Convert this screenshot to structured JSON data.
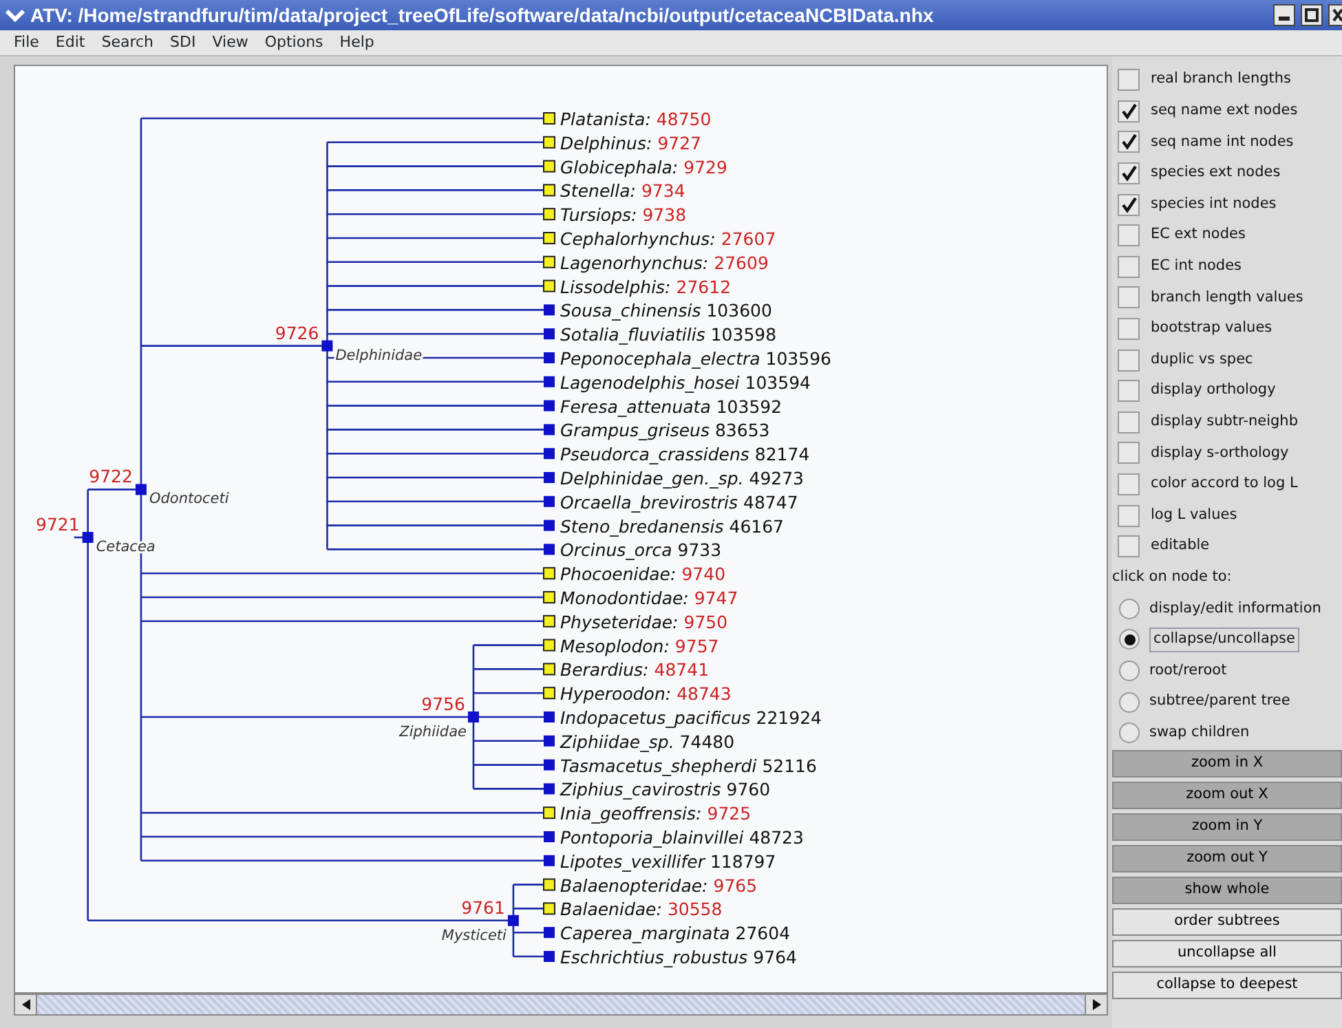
{
  "window": {
    "title": "ATV: /Home/strandfuru/tim/data/project_treeOfLife/software/data/ncbi/output/cetaceaNCBIData.nhx"
  },
  "menu": [
    "File",
    "Edit",
    "Search",
    "SDI",
    "View",
    "Options",
    "Help"
  ],
  "tree": {
    "kind": "internal",
    "label": "Cetacea",
    "id": "9721",
    "children": [
      {
        "kind": "internal",
        "label": "Odontoceti",
        "id": "9722",
        "children": [
          {
            "kind": "collapsed",
            "name": "Platanista:",
            "id": "48750"
          },
          {
            "kind": "internal",
            "label": "Delphinidae",
            "id": "9726",
            "children": [
              {
                "kind": "collapsed",
                "name": "Delphinus:",
                "id": "9727"
              },
              {
                "kind": "collapsed",
                "name": "Globicephala:",
                "id": "9729"
              },
              {
                "kind": "collapsed",
                "name": "Stenella:",
                "id": "9734"
              },
              {
                "kind": "collapsed",
                "name": "Tursiops:",
                "id": "9738"
              },
              {
                "kind": "collapsed",
                "name": "Cephalorhynchus:",
                "id": "27607"
              },
              {
                "kind": "collapsed",
                "name": "Lagenorhynchus:",
                "id": "27609"
              },
              {
                "kind": "collapsed",
                "name": "Lissodelphis:",
                "id": "27612"
              },
              {
                "kind": "leaf",
                "name": "Sousa_chinensis",
                "id": "103600"
              },
              {
                "kind": "leaf",
                "name": "Sotalia_fluviatilis",
                "id": "103598"
              },
              {
                "kind": "leaf",
                "name": "Peponocephala_electra",
                "id": "103596"
              },
              {
                "kind": "leaf",
                "name": "Lagenodelphis_hosei",
                "id": "103594"
              },
              {
                "kind": "leaf",
                "name": "Feresa_attenuata",
                "id": "103592"
              },
              {
                "kind": "leaf",
                "name": "Grampus_griseus",
                "id": "83653"
              },
              {
                "kind": "leaf",
                "name": "Pseudorca_crassidens",
                "id": "82174"
              },
              {
                "kind": "leaf",
                "name": "Delphinidae_gen._sp.",
                "id": "49273"
              },
              {
                "kind": "leaf",
                "name": "Orcaella_brevirostris",
                "id": "48747"
              },
              {
                "kind": "leaf",
                "name": "Steno_bredanensis",
                "id": "46167"
              },
              {
                "kind": "leaf",
                "name": "Orcinus_orca",
                "id": "9733"
              }
            ]
          },
          {
            "kind": "collapsed",
            "name": "Phocoenidae:",
            "id": "9740"
          },
          {
            "kind": "collapsed",
            "name": "Monodontidae:",
            "id": "9747"
          },
          {
            "kind": "collapsed",
            "name": "Physeteridae:",
            "id": "9750"
          },
          {
            "kind": "internal",
            "label": "Ziphiidae",
            "id": "9756",
            "children": [
              {
                "kind": "collapsed",
                "name": "Mesoplodon:",
                "id": "9757"
              },
              {
                "kind": "collapsed",
                "name": "Berardius:",
                "id": "48741"
              },
              {
                "kind": "collapsed",
                "name": "Hyperoodon:",
                "id": "48743"
              },
              {
                "kind": "leaf",
                "name": "Indopacetus_pacificus",
                "id": "221924"
              },
              {
                "kind": "leaf",
                "name": "Ziphiidae_sp.",
                "id": "74480"
              },
              {
                "kind": "leaf",
                "name": "Tasmacetus_shepherdi",
                "id": "52116"
              },
              {
                "kind": "leaf",
                "name": "Ziphius_cavirostris",
                "id": "9760"
              }
            ]
          },
          {
            "kind": "collapsed",
            "name": "Inia_geoffrensis:",
            "id": "9725"
          },
          {
            "kind": "leaf",
            "name": "Pontoporia_blainvillei",
            "id": "48723"
          },
          {
            "kind": "leaf",
            "name": "Lipotes_vexillifer",
            "id": "118797"
          }
        ]
      },
      {
        "kind": "internal",
        "label": "Mysticeti",
        "id": "9761",
        "children": [
          {
            "kind": "collapsed",
            "name": "Balaenopteridae:",
            "id": "9765"
          },
          {
            "kind": "collapsed",
            "name": "Balaenidae:",
            "id": "30558"
          },
          {
            "kind": "leaf",
            "name": "Caperea_marginata",
            "id": "27604"
          },
          {
            "kind": "leaf",
            "name": "Eschrichtius_robustus",
            "id": "9764"
          }
        ]
      }
    ]
  },
  "options": [
    {
      "label": "real branch lengths",
      "checked": false
    },
    {
      "label": "seq name ext nodes",
      "checked": true
    },
    {
      "label": "seq name int nodes",
      "checked": true
    },
    {
      "label": "species ext nodes",
      "checked": true
    },
    {
      "label": "species int nodes",
      "checked": true
    },
    {
      "label": "EC ext nodes",
      "checked": false
    },
    {
      "label": "EC int nodes",
      "checked": false
    },
    {
      "label": "branch length values",
      "checked": false
    },
    {
      "label": "bootstrap values",
      "checked": false
    },
    {
      "label": "duplic vs spec",
      "checked": false
    },
    {
      "label": "display orthology",
      "checked": false
    },
    {
      "label": "display subtr-neighb",
      "checked": false
    },
    {
      "label": "display s-orthology",
      "checked": false
    },
    {
      "label": "color accord to log L",
      "checked": false
    },
    {
      "label": "log L values",
      "checked": false
    },
    {
      "label": "editable",
      "checked": false
    }
  ],
  "click_heading": "click on node to:",
  "click_actions": [
    {
      "label": "display/edit information",
      "selected": false
    },
    {
      "label": "collapse/uncollapse",
      "selected": true
    },
    {
      "label": "root/reroot",
      "selected": false
    },
    {
      "label": "subtree/parent tree",
      "selected": false
    },
    {
      "label": "swap children",
      "selected": false
    }
  ],
  "buttons": [
    {
      "label": "zoom in X",
      "kind": "view"
    },
    {
      "label": "zoom out X",
      "kind": "view"
    },
    {
      "label": "zoom in Y",
      "kind": "view"
    },
    {
      "label": "zoom out Y",
      "kind": "view"
    },
    {
      "label": "show whole",
      "kind": "view"
    },
    {
      "label": "order subtrees",
      "kind": "tree"
    },
    {
      "label": "uncollapse all",
      "kind": "tree"
    },
    {
      "label": "collapse to deepest",
      "kind": "tree"
    }
  ]
}
